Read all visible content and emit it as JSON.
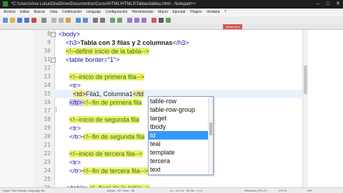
{
  "window": {
    "title": "*C:\\Users\\Ana Luisa\\OneDrive\\Documentos\\Curso\\HTML\\HTML5\\Tablas\\tablas.html - Notepad++",
    "controls": [
      "–",
      "□",
      "✕"
    ]
  },
  "menu": [
    "Archivo",
    "Editar",
    "Buscar",
    "Vista",
    "Codificación",
    "Lenguaje",
    "Configuración",
    "Herramientas",
    "Macro",
    "Ejecutar",
    "Plugins",
    "Ventana",
    "?"
  ],
  "tab": {
    "label": "tablas.html"
  },
  "editor": {
    "lines": [
      {
        "num": "8",
        "indent": "",
        "parts": [
          {
            "t": "<body>",
            "c": "tag"
          }
        ]
      },
      {
        "num": "9",
        "indent": "    ",
        "parts": [
          {
            "t": "<h3>",
            "c": "tag"
          },
          {
            "t": "Tabla con 3 filas y 2 columnas",
            "c": "bold"
          },
          {
            "t": "</h3>",
            "c": "tag"
          }
        ]
      },
      {
        "num": "10",
        "indent": "    ",
        "parts": [
          {
            "t": "<!--definir inicio de la tabla-->",
            "c": "comment"
          }
        ]
      },
      {
        "num": "11",
        "indent": "    ",
        "parts": [
          {
            "t": "<table border=\"1\">",
            "c": "tag"
          }
        ]
      },
      {
        "num": "12",
        "indent": "",
        "parts": []
      },
      {
        "num": "13",
        "indent": "      ",
        "parts": [
          {
            "t": "<!--inicio de primera fila-->",
            "c": "comment"
          }
        ]
      },
      {
        "num": "14",
        "indent": "      ",
        "parts": [
          {
            "t": "<tr>",
            "c": "tag"
          }
        ]
      },
      {
        "num": "15",
        "indent": "        ",
        "parts": [
          {
            "t": "<td>",
            "c": "tag-hl"
          },
          {
            "t": "Fila1, Columna1",
            "c": "text"
          },
          {
            "t": "</td",
            "c": "tag-hl"
          }
        ]
      },
      {
        "num": "16",
        "indent": "      ",
        "parts": [
          {
            "t": "</tr>",
            "c": "tr-hl"
          },
          {
            "t": "<!--fin de primera fila",
            "c": "comment"
          }
        ]
      },
      {
        "num": "17",
        "indent": "",
        "parts": []
      },
      {
        "num": "18",
        "indent": "      ",
        "parts": [
          {
            "t": "<!--inicio de segunda fila",
            "c": "comment"
          }
        ]
      },
      {
        "num": "19",
        "indent": "      ",
        "parts": [
          {
            "t": "<tr>",
            "c": "tag"
          }
        ]
      },
      {
        "num": "20",
        "indent": "      ",
        "parts": [
          {
            "t": "</tr>",
            "c": "tag"
          },
          {
            "t": "<!--fin de segunda fila",
            "c": "comment"
          }
        ]
      },
      {
        "num": "21",
        "indent": "",
        "parts": []
      },
      {
        "num": "22",
        "indent": "      ",
        "parts": [
          {
            "t": "<!--inicio de tercera fila-->",
            "c": "comment"
          }
        ]
      },
      {
        "num": "23",
        "indent": "      ",
        "parts": [
          {
            "t": "<tr>",
            "c": "tag"
          }
        ]
      },
      {
        "num": "24",
        "indent": "      ",
        "parts": [
          {
            "t": "</tr>",
            "c": "tag"
          },
          {
            "t": "<!--fin de tercera fila-->",
            "c": "comment"
          }
        ]
      },
      {
        "num": "25",
        "indent": "",
        "parts": []
      },
      {
        "num": "26",
        "indent": "    ",
        "parts": [
          {
            "t": "</table>",
            "c": "tag"
          },
          {
            "t": "<!--final de la tabla-->",
            "c": "comment"
          }
        ]
      }
    ]
  },
  "autocomplete": {
    "items": [
      "table-row",
      "table-row-group",
      "target",
      "tbody",
      "td",
      "teal",
      "template",
      "tercera",
      "text"
    ],
    "selected": "td"
  },
  "status": {
    "left": "Hyper Text Markup Language file",
    "middle": "length : 517    lines : 35",
    "position": "Ln : 15    Col : 30    Sel : 0 | 0",
    "eol": "Windows (CR LF)",
    "encoding": "UTF-8",
    "mode": "INS"
  },
  "colors": {
    "tag": "#1a1aa6",
    "comment": "#1f7a1f",
    "comment_bg": "#f1f06b",
    "selected_item": "#3399ff"
  }
}
